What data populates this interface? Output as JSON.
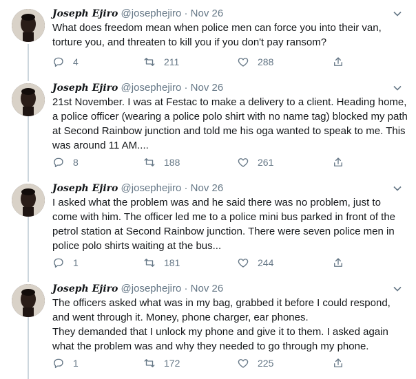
{
  "tweets": [
    {
      "name": "Joseph Ejiro",
      "handle": "@josephejiro",
      "sep": "·",
      "date": "Nov 26",
      "text": "What does freedom mean when police men can force you into their van, torture you, and threaten to kill you if you don't pay ransom?",
      "replies": "4",
      "retweets": "211",
      "likes": "288"
    },
    {
      "name": "Joseph Ejiro",
      "handle": "@josephejiro",
      "sep": "·",
      "date": "Nov 26",
      "text": "21st November. I was at Festac to make a delivery to a client. Heading home, a police officer (wearing a police polo shirt with no name tag) blocked my path at Second Rainbow junction and told me his oga wanted to speak to me. This was around 11 AM....",
      "replies": "8",
      "retweets": "188",
      "likes": "261"
    },
    {
      "name": "Joseph Ejiro",
      "handle": "@josephejiro",
      "sep": "·",
      "date": "Nov 26",
      "text": "I asked what the problem was and he said there was no problem, just to come with him. The officer led me to a police mini bus parked in front of the petrol station at Second Rainbow junction. There were seven police men in police polo shirts waiting at the bus...",
      "replies": "1",
      "retweets": "181",
      "likes": "244"
    },
    {
      "name": "Joseph Ejiro",
      "handle": "@josephejiro",
      "sep": "·",
      "date": "Nov 26",
      "text": "The officers asked what was in my bag, grabbed it before I could respond, and went through it. Money, phone charger, ear phones.\nThey demanded that I unlock my phone and give it to them. I asked again what the problem was and why they needed to go through my phone.",
      "replies": "1",
      "retweets": "172",
      "likes": "225"
    }
  ],
  "icons": [
    "reply-icon",
    "retweet-icon",
    "like-icon",
    "share-icon",
    "chevron-down-icon"
  ],
  "colors": {
    "text": "#14171a",
    "muted": "#657786",
    "thread": "#ccd6dd",
    "background": "#ffffff"
  }
}
